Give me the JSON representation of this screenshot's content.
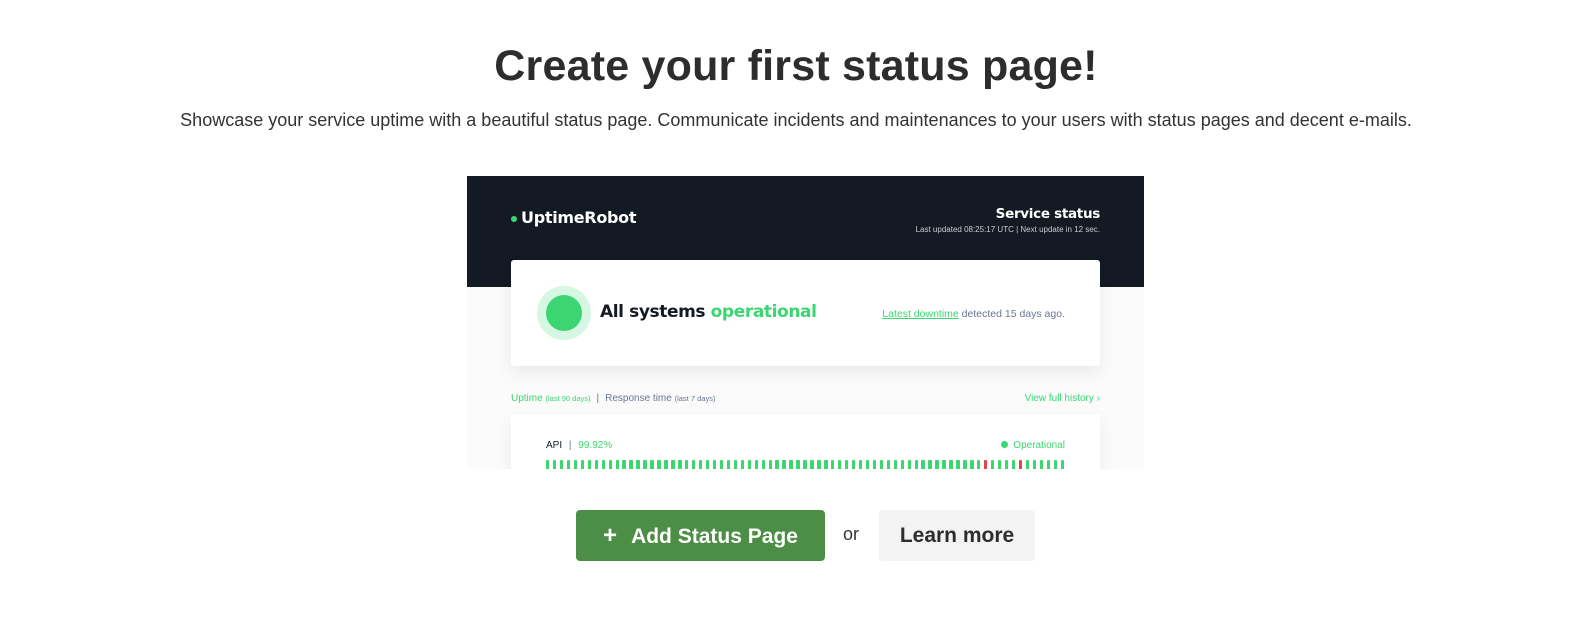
{
  "hero": {
    "title": "Create your first status page!",
    "subtitle": "Showcase your service uptime with a beautiful status page. Communicate incidents and maintenances to your users with status pages and decent e-mails."
  },
  "preview": {
    "brand": "UptimeRobot",
    "service_title": "Service status",
    "last_updated": "Last updated  08:25:17 UTC | Next update in 12 sec.",
    "status_prefix": "All systems ",
    "status_word": "operational",
    "downtime_link": "Latest downtime",
    "downtime_rest": " detected 15 days ago.",
    "tab_uptime": "Uptime",
    "tab_uptime_range": "(last 90 days)",
    "tab_separator": "|",
    "tab_response": "Response time",
    "tab_response_range": "(last 7 days)",
    "view_history": "View full history ›",
    "monitor": {
      "name": "API",
      "separator": "|",
      "uptime": "99.92%",
      "status": "Operational",
      "bar_count": 90,
      "down_bars": [
        76,
        82
      ]
    },
    "colors": {
      "header_bg": "#141a24",
      "up": "#3bd671",
      "down": "#df484a"
    }
  },
  "actions": {
    "add_label": "Add Status Page",
    "add_icon": "plus-icon",
    "or_text": "or",
    "learn_label": "Learn more",
    "add_color": "#4c8e45"
  }
}
